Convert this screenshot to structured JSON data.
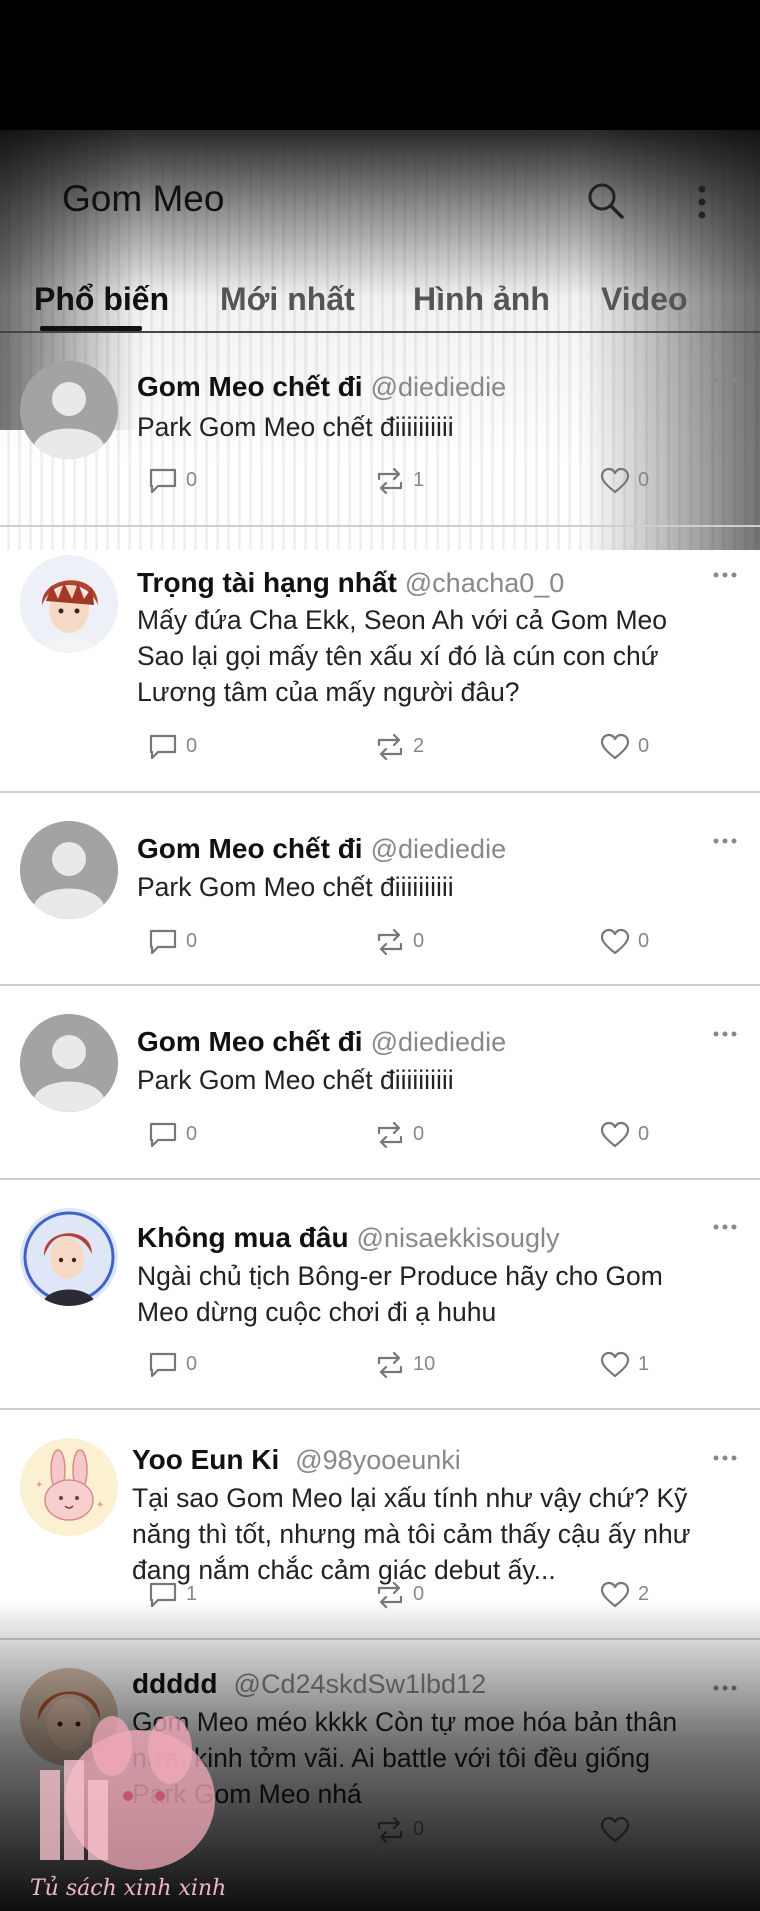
{
  "app": {
    "title": "Gom Meo"
  },
  "tabs": [
    {
      "label": "Phổ biến",
      "active": true
    },
    {
      "label": "Mới nhất",
      "active": false
    },
    {
      "label": "Hình ảnh",
      "active": false
    },
    {
      "label": "Video",
      "active": false
    }
  ],
  "posts": [
    {
      "name": "Gom Meo chết đi",
      "handle": "@diediedie",
      "text": "Park Gom Meo chết điiiiiiiiii",
      "comments": "0",
      "retweets": "1",
      "likes": "0",
      "avatar": "default-avatar"
    },
    {
      "name": "Trọng tài hạng nhất",
      "handle": "@chacha0_0",
      "text": "Mấy đứa Cha Ekk, Seon Ah với cả Gom Meo Sao lại gọi mấy tên xấu xí đó là cún con chứ Lương tâm của mấy người đâu?",
      "comments": "0",
      "retweets": "2",
      "likes": "0",
      "avatar": "red-hair-boy-avatar"
    },
    {
      "name": "Gom Meo chết đi",
      "handle": "@diediedie",
      "text": "Park Gom Meo chết điiiiiiiiii",
      "comments": "0",
      "retweets": "0",
      "likes": "0",
      "avatar": "default-avatar"
    },
    {
      "name": "Gom Meo chết đi",
      "handle": "@diediedie",
      "text": "Park Gom Meo chết điiiiiiiiii",
      "comments": "0",
      "retweets": "0",
      "likes": "0",
      "avatar": "default-avatar"
    },
    {
      "name": "Không mua đâu",
      "handle": "@nisaekkisougly",
      "text": "Ngài chủ tịch Bông-er Produce hãy cho Gom Meo dừng cuộc chơi đi ạ huhu",
      "comments": "0",
      "retweets": "10",
      "likes": "1",
      "avatar": "red-hair-boy-avatar"
    },
    {
      "name": "Yoo Eun Ki",
      "handle": "@98yooeunki",
      "text": "Tại sao Gom Meo lại xấu tính như vậy chứ? Kỹ năng thì tốt, nhưng mà tôi cảm thấy cậu ấy như đang nắm chắc cảm giác debut ấy...",
      "comments": "1",
      "retweets": "0",
      "likes": "2",
      "avatar": "bunny-avatar"
    },
    {
      "name": "ddddd",
      "handle": "@Cd24skdSw1lbd12",
      "text": "Gom Meo méo kkkk Còn tự moe hóa bản thân nữa, kinh tởm vãi. Ai battle với tôi đều giống Park Gom Meo nhá",
      "comments": "",
      "retweets": "0",
      "likes": "",
      "avatar": "orange-hair-avatar"
    }
  ],
  "watermark": {
    "text": "Tủ sách xinh xinh"
  },
  "colors": {
    "accent": "#111111",
    "muted": "#888888",
    "divider": "#cfcfcf"
  }
}
